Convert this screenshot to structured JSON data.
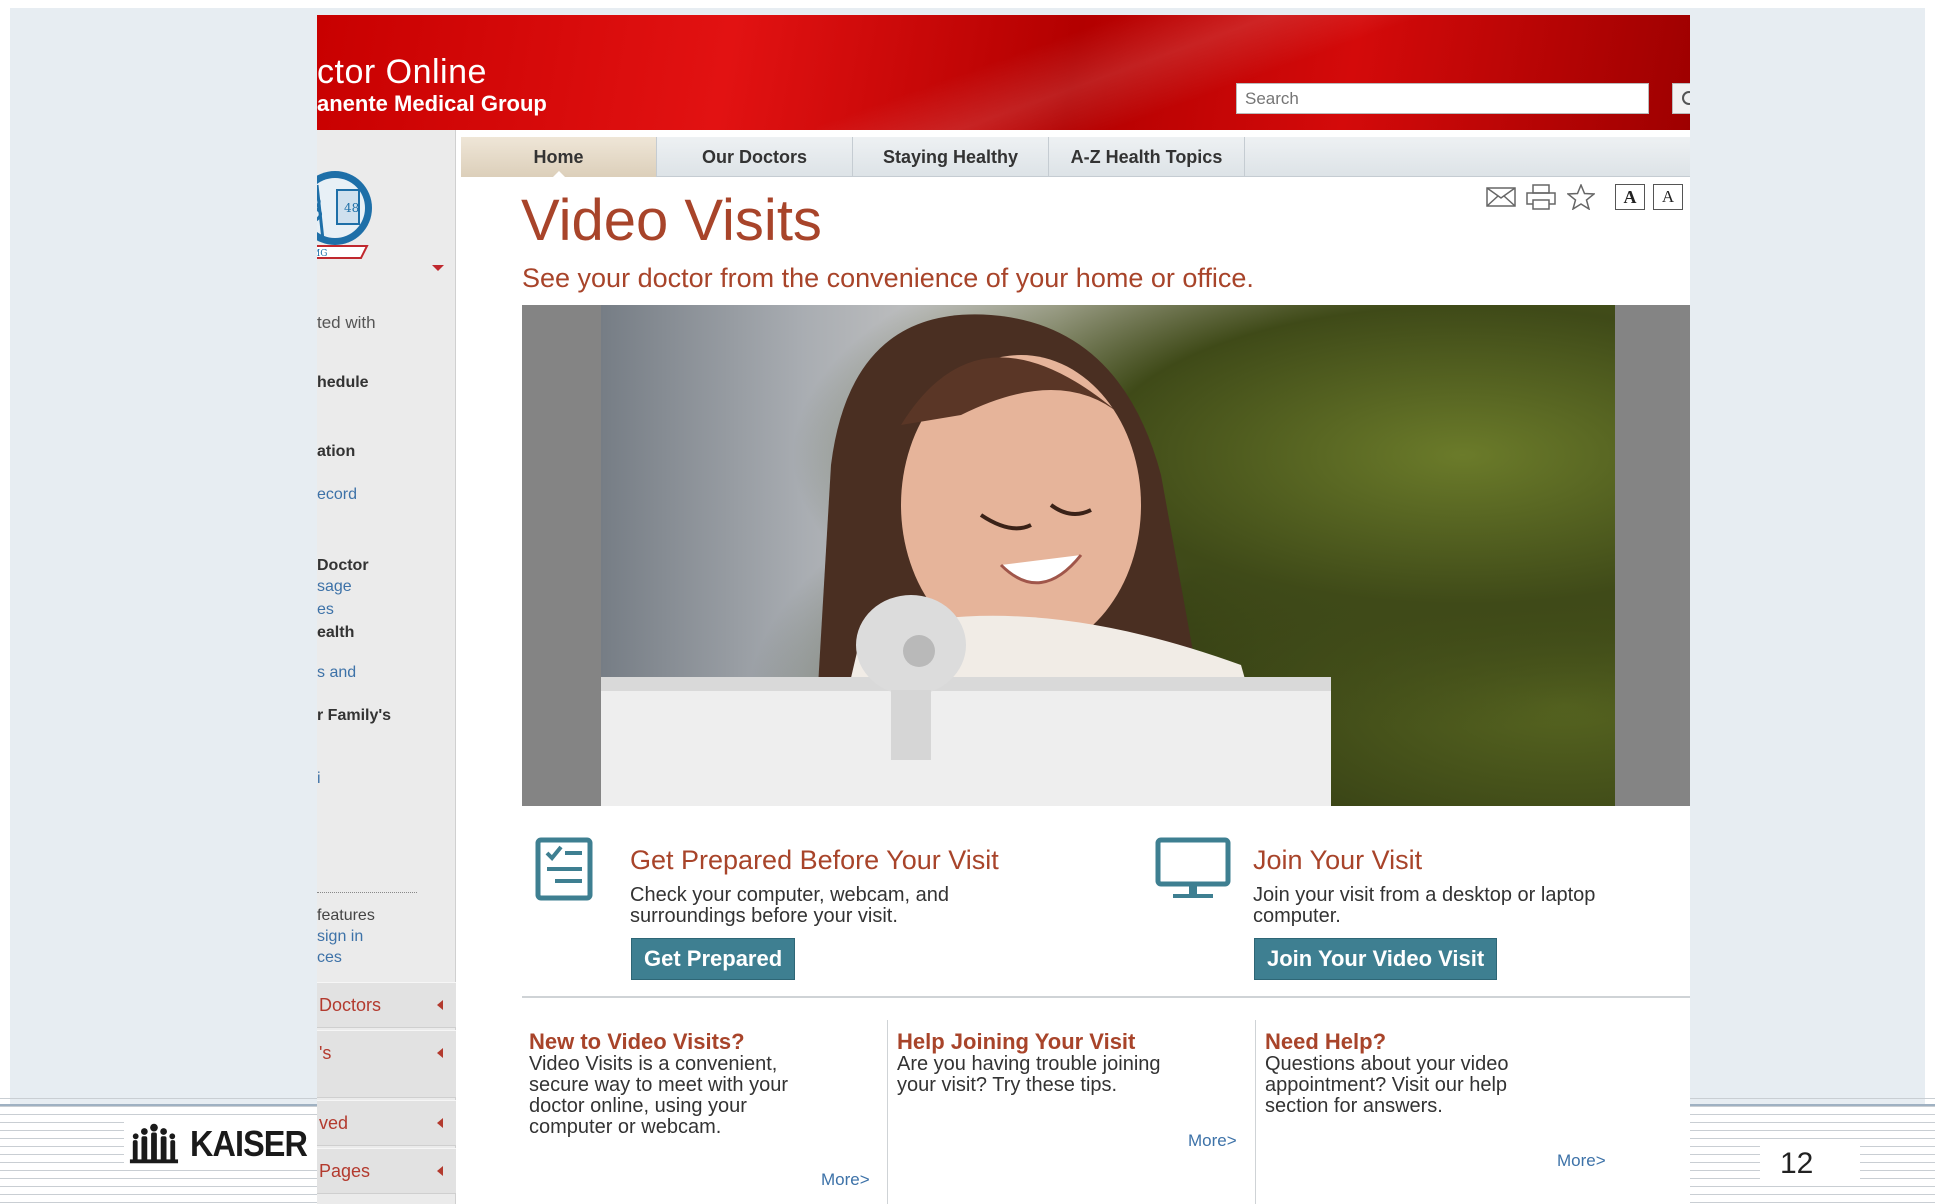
{
  "slide": {
    "logo_text": "KAISER",
    "page_number": "12"
  },
  "header": {
    "brand_title": "ctor Online",
    "brand_subtitle": "anente Medical Group",
    "search_placeholder": "Search",
    "color": "#c80000"
  },
  "sidebar": {
    "items": [
      {
        "label": "ted with",
        "style": "bold"
      },
      {
        "label": "hedule",
        "style": "bold"
      },
      {
        "label": "ation",
        "style": "bold"
      },
      {
        "label": "ecord",
        "style": "link"
      },
      {
        "label": "Doctor",
        "style": "bold"
      },
      {
        "label": "sage",
        "style": "link"
      },
      {
        "label": "es",
        "style": "link"
      },
      {
        "label": "ealth",
        "style": "bold"
      },
      {
        "label": "s and",
        "style": "link"
      },
      {
        "label": "r Family's",
        "style": "bold"
      },
      {
        "label": "i",
        "style": "link"
      },
      {
        "label": "features",
        "style": "plain"
      },
      {
        "label": "sign in",
        "style": "link"
      },
      {
        "label": "ces",
        "style": "link"
      }
    ],
    "collapsibles": [
      {
        "label": "Doctors"
      },
      {
        "label": "'s"
      },
      {
        "label": "ved"
      },
      {
        "label": "Pages"
      }
    ]
  },
  "nav": {
    "tabs": [
      {
        "label": "Home",
        "active": true
      },
      {
        "label": "Our Doctors",
        "active": false
      },
      {
        "label": "Staying Healthy",
        "active": false
      },
      {
        "label": "A-Z Health Topics",
        "active": false
      }
    ]
  },
  "tools": {
    "icons": [
      "email-icon",
      "print-icon",
      "star-icon"
    ],
    "text_larger": "A",
    "text_smaller": "A"
  },
  "main": {
    "title": "Video Visits",
    "subtitle": "See your doctor from the convenience of your home or office.",
    "accent_color": "#a8442a",
    "features": [
      {
        "icon": "checklist-icon",
        "title": "Get Prepared Before Your Visit",
        "text_line1": "Check your computer, webcam, and",
        "text_line2": "surroundings before your visit.",
        "button": "Get Prepared"
      },
      {
        "icon": "monitor-icon",
        "title": "Join Your Visit",
        "text_line1": "Join your visit from a desktop or laptop",
        "text_line2": "computer.",
        "button": "Join Your Video Visit"
      }
    ],
    "columns": [
      {
        "title": "New to Video Visits?",
        "lines": [
          "Video Visits is a convenient,",
          "secure way to meet with your",
          "doctor online, using your",
          "computer or webcam."
        ],
        "more": "More>"
      },
      {
        "title": "Help Joining Your Visit",
        "lines": [
          "Are you having trouble joining",
          "your visit? Try these tips."
        ],
        "more": "More>"
      },
      {
        "title": "Need Help?",
        "lines": [
          "Questions about your video",
          "appointment? Visit our help",
          "section for answers."
        ],
        "more": "More>"
      }
    ],
    "button_color": "#3e7f91"
  }
}
